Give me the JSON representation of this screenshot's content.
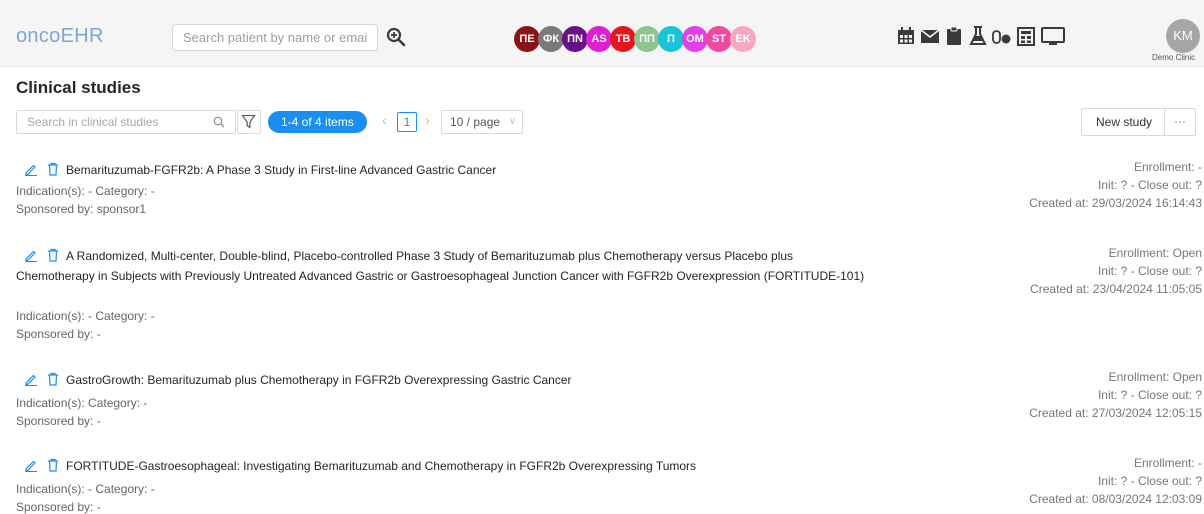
{
  "app": {
    "logo": "oncoEHR"
  },
  "header": {
    "search_placeholder": "Search patient by name or email",
    "patient_bubbles": [
      {
        "label": "ПЕ",
        "color": "#8b1218"
      },
      {
        "label": "ФК",
        "color": "#7a7a7a"
      },
      {
        "label": "ПN",
        "color": "#6a0f8a"
      },
      {
        "label": "AS",
        "color": "#e01fd0"
      },
      {
        "label": "TB",
        "color": "#e8141c"
      },
      {
        "label": "ПП",
        "color": "#8ec48f"
      },
      {
        "label": "П",
        "color": "#16c6d8"
      },
      {
        "label": "OM",
        "color": "#e040e8"
      },
      {
        "label": "ST",
        "color": "#f04aa0"
      },
      {
        "label": "EK",
        "color": "#f8a8c0"
      }
    ],
    "tools": [
      "calendar-icon",
      "mail-icon",
      "clipboard-icon",
      "flask-icon",
      "pills-icon",
      "calculator-icon",
      "monitor-icon"
    ],
    "user": {
      "initials": "KM",
      "clinic": "Demo Clinic"
    }
  },
  "page": {
    "title": "Clinical studies"
  },
  "toolbar": {
    "search_placeholder": "Search in clinical studies",
    "count_badge": "1-4 of 4 items",
    "current_page": "1",
    "page_size": "10 / page",
    "new_study_label": "New study",
    "more_label": "···"
  },
  "studies": [
    {
      "title": "Bemarituzumab-FGFR2b: A Phase 3 Study in First-line Advanced Gastric Cancer",
      "indication": "Indication(s): -   Category: -",
      "sponsor": "Sponsored by: sponsor1",
      "enrollment": "Enrollment: -",
      "init": "Init: ? - Close out: ?",
      "created": "Created at: 29/03/2024 16:14:43"
    },
    {
      "title": "A Randomized, Multi-center, Double-blind, Placebo-controlled Phase 3 Study of Bemarituzumab plus Chemotherapy versus Placebo plus Chemotherapy in Subjects with Previously Untreated Advanced Gastric or Gastroesophageal Junction Cancer with FGFR2b Overexpression (FORTITUDE-101)",
      "indication": "Indication(s): -   Category: -",
      "sponsor": "Sponsored by: -",
      "enrollment": "Enrollment: Open",
      "init": "Init: ? - Close out: ?",
      "created": "Created at: 23/04/2024 11:05:05"
    },
    {
      "title": "GastroGrowth: Bemarituzumab plus Chemotherapy in FGFR2b Overexpressing Gastric Cancer",
      "indication": "Indication(s):   Category: -",
      "sponsor": "Sponsored by: -",
      "enrollment": "Enrollment: Open",
      "init": "Init: ? - Close out: ?",
      "created": "Created at: 27/03/2024 12:05:15"
    },
    {
      "title": "FORTITUDE-Gastroesophageal: Investigating Bemarituzumab and Chemotherapy in FGFR2b Overexpressing Tumors",
      "indication": "Indication(s): -   Category: -",
      "sponsor": "Sponsored by: -",
      "enrollment": "Enrollment: -",
      "init": "Init: ? - Close out: ?",
      "created": "Created at: 08/03/2024 12:03:09"
    }
  ]
}
